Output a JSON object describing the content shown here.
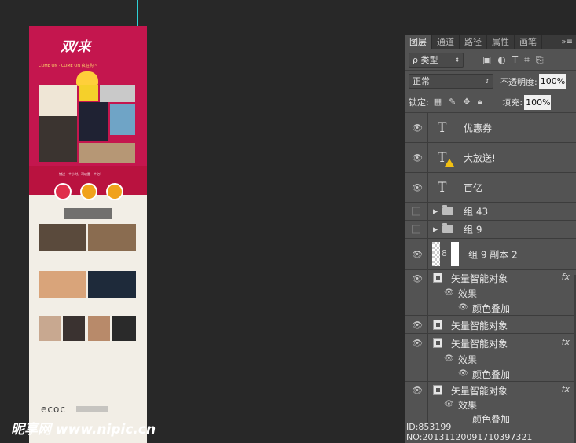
{
  "canvas": {
    "logo": "双/来",
    "slogan": "COME ON · COME ON 疯狂购 ~",
    "band_message": "错过一个小时，可以是一个亿？",
    "footer_logo": "ecoc"
  },
  "watermark": "昵享网 www.nipic.cn",
  "id_line": "ID:853199 NO:20131120091710397321",
  "panel": {
    "tabs": [
      "图层",
      "通道",
      "路径",
      "属性",
      "画笔"
    ],
    "menu_icon": "»≡",
    "filter_label": "ρ 类型",
    "blend_mode": "正常",
    "opacity_label": "不透明度:",
    "opacity_value": "100%",
    "lock_label": "锁定:",
    "fill_label": "填充:",
    "fill_value": "100%",
    "text_layers": [
      {
        "name": "优惠券"
      },
      {
        "name": "大放送!"
      },
      {
        "name": "百亿"
      }
    ],
    "groups": [
      {
        "name": "组 43"
      },
      {
        "name": "组 9"
      }
    ],
    "pixel_layer": {
      "name": "组 9 副本 2"
    },
    "smart_layers": [
      {
        "name": "矢量智能对象",
        "effects": "效果",
        "overlay": "颜色叠加"
      },
      {
        "name": "矢量智能对象"
      },
      {
        "name": "矢量智能对象",
        "effects": "效果",
        "overlay": "颜色叠加"
      },
      {
        "name": "矢量智能对象",
        "effects": "效果",
        "overlay": "颜色叠加"
      }
    ],
    "fx_label": "fx"
  }
}
